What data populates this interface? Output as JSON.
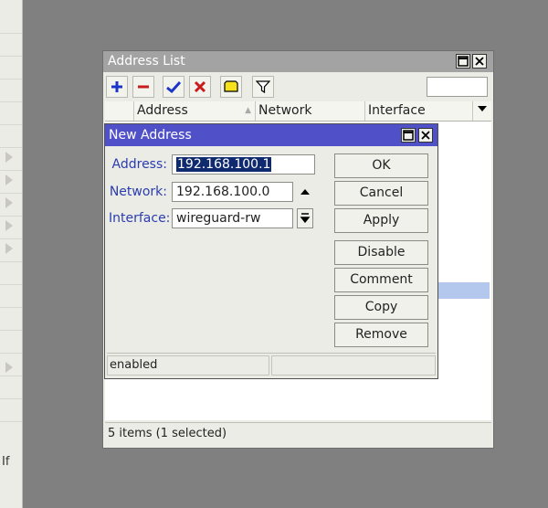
{
  "sidebar": {
    "partial_label": "If"
  },
  "address_list": {
    "title": "Address List",
    "toolbar": {
      "add": "add-icon",
      "remove": "remove-icon",
      "enable": "check-icon",
      "disable": "x-icon",
      "comment": "note-icon",
      "filter": "filter-icon"
    },
    "columns": [
      "Address",
      "Network",
      "Interface"
    ],
    "status": "5 items (1 selected)",
    "find_value": ""
  },
  "new_address": {
    "title": "New Address",
    "fields": {
      "address_label": "Address:",
      "address_value": "192.168.100.1",
      "network_label": "Network:",
      "network_value": "192.168.100.0",
      "interface_label": "Interface:",
      "interface_value": "wireguard-rw"
    },
    "buttons": {
      "ok": "OK",
      "cancel": "Cancel",
      "apply": "Apply",
      "disable": "Disable",
      "comment": "Comment",
      "copy": "Copy",
      "remove": "Remove"
    },
    "status": "enabled"
  },
  "colors": {
    "dialog_title_bg": "#5050c8",
    "inactive_title_bg": "#a3a3a3",
    "label_blue": "#2a3cb0",
    "selected_row": "#b3c8ec"
  }
}
